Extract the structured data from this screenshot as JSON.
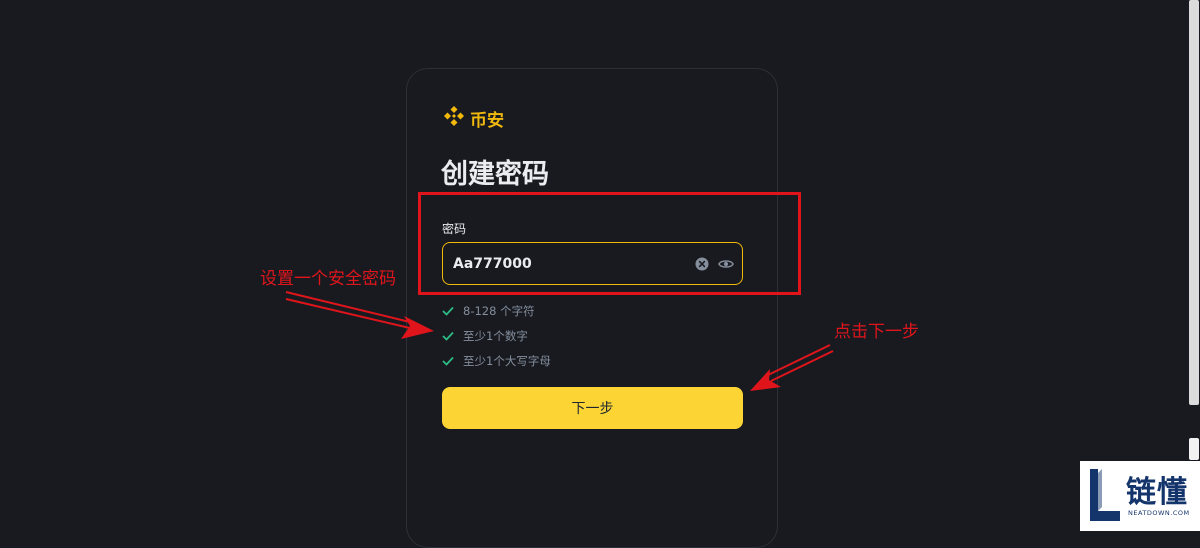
{
  "brand": {
    "name": "币安",
    "color": "#f0b90b",
    "icon": "binance-logo-icon"
  },
  "page": {
    "title": "创建密码"
  },
  "password": {
    "label": "密码",
    "value": "Aa777000",
    "clear_icon": "clear-icon",
    "toggle_icon": "eye-icon"
  },
  "rules": [
    {
      "text": "8-128 个字符",
      "icon": "check-icon"
    },
    {
      "text": "至少1个数字",
      "icon": "check-icon"
    },
    {
      "text": "至少1个大写字母",
      "icon": "check-icon"
    }
  ],
  "next_button": {
    "label": "下一步",
    "color": "#fcd535"
  },
  "annotations": {
    "left": "设置一个安全密码",
    "right": "点击下一步",
    "color": "#e0151b"
  },
  "watermark": {
    "chinese": "链懂",
    "english": "NEATDOWN.COM"
  }
}
